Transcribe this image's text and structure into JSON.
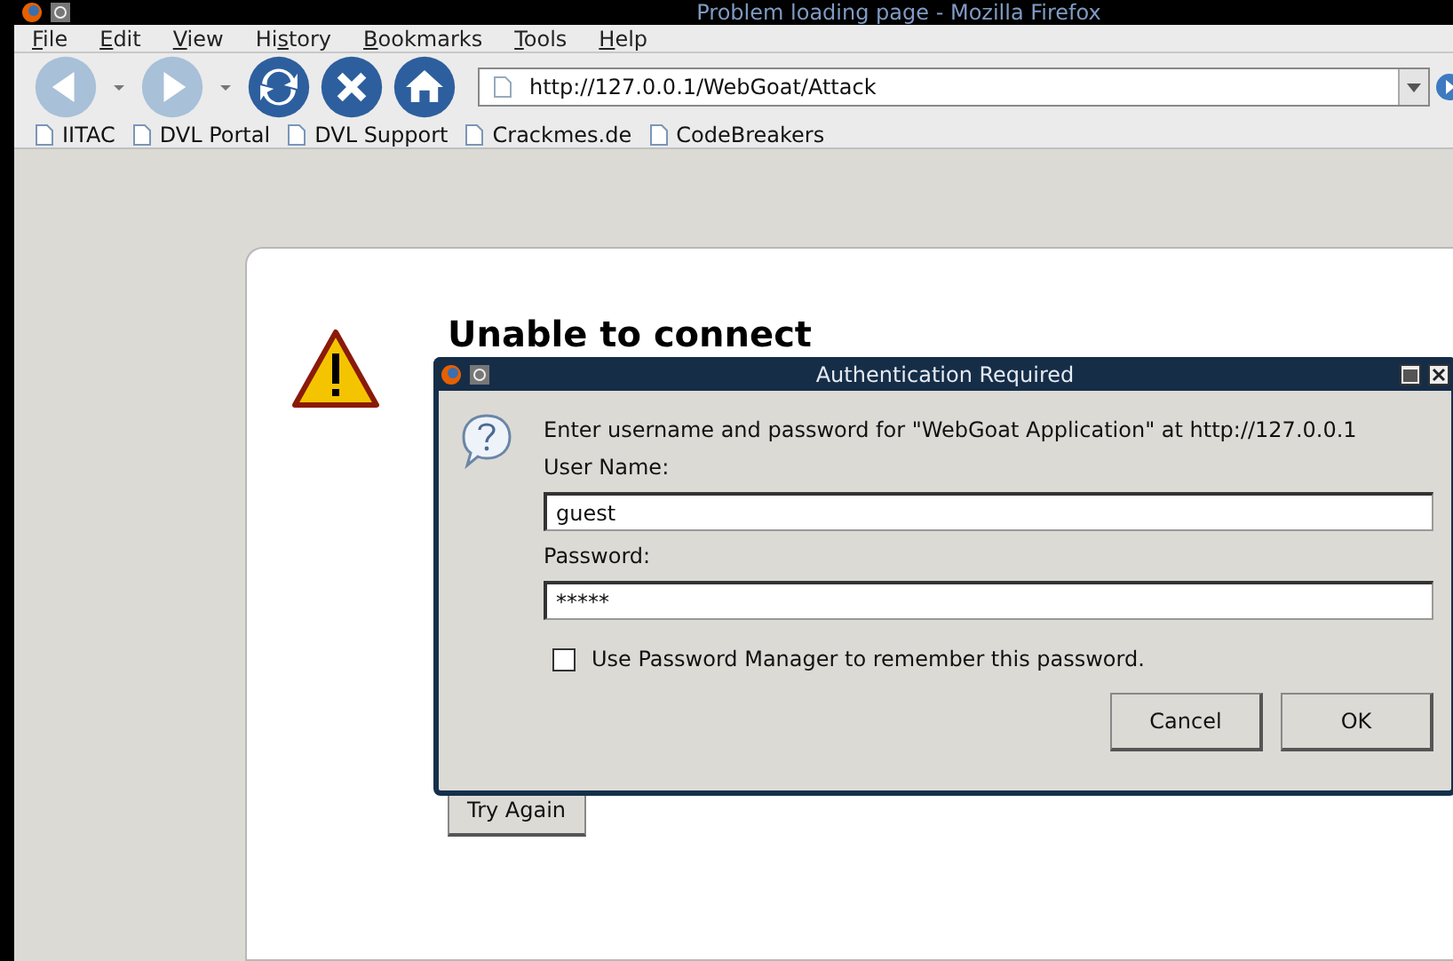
{
  "window": {
    "title": "Problem loading page - Mozilla Firefox"
  },
  "menu": [
    {
      "key": "F",
      "after": "ile"
    },
    {
      "key": "E",
      "after": "dit"
    },
    {
      "key": "V",
      "after": "iew"
    },
    {
      "before": "Hi",
      "key": "s",
      "after": "tory"
    },
    {
      "key": "B",
      "after": "ookmarks"
    },
    {
      "key": "T",
      "after": "ools"
    },
    {
      "key": "H",
      "after": "elp"
    }
  ],
  "address": {
    "value": "http://127.0.0.1/WebGoat/Attack"
  },
  "bookmarks": [
    "IITAC",
    "DVL Portal",
    "DVL Support",
    "Crackmes.de",
    "CodeBreakers"
  ],
  "error_page": {
    "title": "Unable to connect",
    "button": "Try Again"
  },
  "dialog": {
    "title": "Authentication Required",
    "message": "Enter username and password for \"WebGoat Application\" at http://127.0.0.1",
    "username_label": "User Name:",
    "username": "guest",
    "password_label": "Password:",
    "password": "*****",
    "remember": {
      "label": "Use Password Manager to remember this password.",
      "checked": false
    },
    "buttons": [
      "Cancel",
      "OK"
    ]
  }
}
